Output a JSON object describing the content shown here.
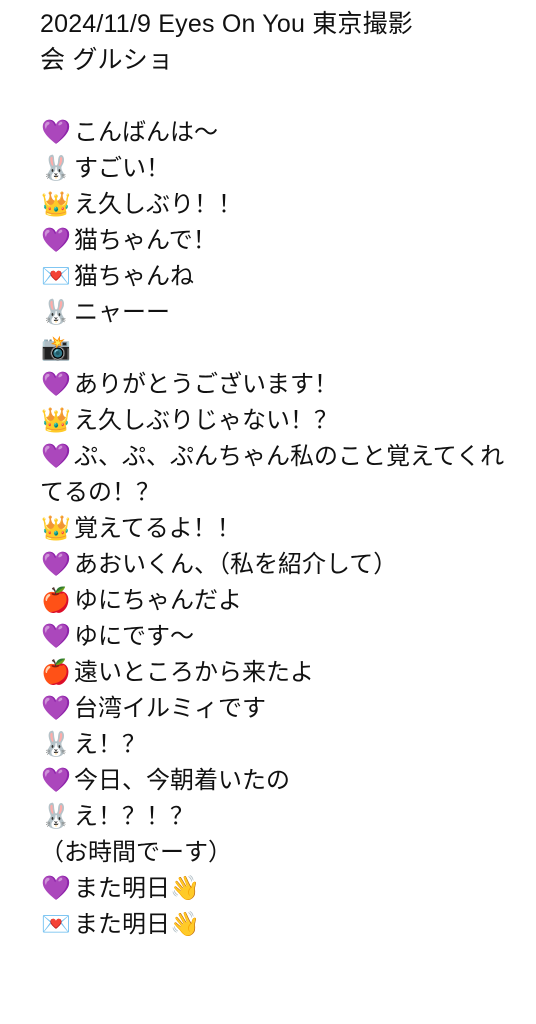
{
  "title": {
    "line1": "2024/11/9 Eyes On You 東京撮影",
    "line2": "会 グルショ"
  },
  "lines": [
    {
      "icon": "💜",
      "icon_name": "purple-heart-icon",
      "text": "こんばんは～"
    },
    {
      "icon": "🐰",
      "icon_name": "rabbit-icon",
      "text": "すごい！"
    },
    {
      "icon": "👑",
      "icon_name": "crown-icon",
      "text": "え久しぶり！！"
    },
    {
      "icon": "💜",
      "icon_name": "purple-heart-icon",
      "text": "猫ちゃんで！"
    },
    {
      "icon": "💌",
      "icon_name": "love-letter-icon",
      "text": "猫ちゃんね"
    },
    {
      "icon": "🐰",
      "icon_name": "rabbit-icon",
      "text": "ニャーー"
    },
    {
      "icon": "📸",
      "icon_name": "camera-flash-icon",
      "text": ""
    },
    {
      "icon": "💜",
      "icon_name": "purple-heart-icon",
      "text": "ありがとうございます！"
    },
    {
      "icon": "👑",
      "icon_name": "crown-icon",
      "text": "え久しぶりじゃない！？"
    },
    {
      "icon": "💜",
      "icon_name": "purple-heart-icon",
      "text": "ぷ、ぷ、ぷんちゃん私のこと覚えてくれてるの！？"
    },
    {
      "icon": "👑",
      "icon_name": "crown-icon",
      "text": "覚えてるよ！！"
    },
    {
      "icon": "💜",
      "icon_name": "purple-heart-icon",
      "text": "あおいくん、（私を紹介して）"
    },
    {
      "icon": "🍎",
      "icon_name": "red-apple-icon",
      "text": "ゆにちゃんだよ"
    },
    {
      "icon": "💜",
      "icon_name": "purple-heart-icon",
      "text": "ゆにです～"
    },
    {
      "icon": "🍎",
      "icon_name": "red-apple-icon",
      "text": "遠いところから来たよ"
    },
    {
      "icon": "💜",
      "icon_name": "purple-heart-icon",
      "text": "台湾イルミィです"
    },
    {
      "icon": "🐰",
      "icon_name": "rabbit-icon",
      "text": "え！？"
    },
    {
      "icon": "💜",
      "icon_name": "purple-heart-icon",
      "text": "今日、今朝着いたの"
    },
    {
      "icon": "🐰",
      "icon_name": "rabbit-icon",
      "text": "え！？！？"
    },
    {
      "icon": "",
      "icon_name": "",
      "text": "（お時間でーす）"
    },
    {
      "icon": "💜",
      "icon_name": "purple-heart-icon",
      "text": "また明日👋"
    },
    {
      "icon": "💌",
      "icon_name": "love-letter-icon",
      "text": "また明日👋"
    }
  ]
}
